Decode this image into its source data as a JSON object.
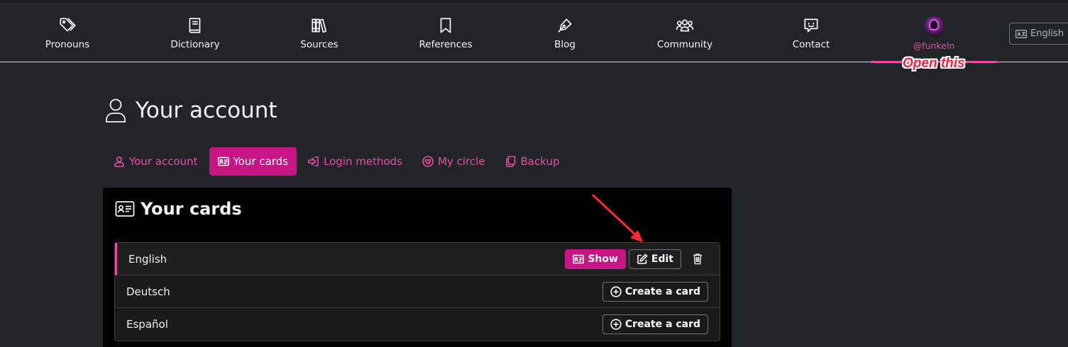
{
  "nav": {
    "items": [
      {
        "label": "Pronouns",
        "icon": "tags-icon"
      },
      {
        "label": "Dictionary",
        "icon": "book-icon"
      },
      {
        "label": "Sources",
        "icon": "books-icon"
      },
      {
        "label": "References",
        "icon": "bookmark-icon"
      },
      {
        "label": "Blog",
        "icon": "pen-nib-icon"
      },
      {
        "label": "Community",
        "icon": "users-icon"
      },
      {
        "label": "Contact",
        "icon": "comment-icon"
      }
    ],
    "user": {
      "label": "@funkeln",
      "icon": "avatar"
    },
    "language": {
      "label": "English",
      "icon": "language-icon"
    }
  },
  "annotation": {
    "text": "Open this",
    "color": "#ff1f3d"
  },
  "page": {
    "title": "Your account"
  },
  "tabs": [
    {
      "label": "Your account",
      "icon": "user-icon",
      "active": false
    },
    {
      "label": "Your cards",
      "icon": "id-card-icon",
      "active": true
    },
    {
      "label": "Login methods",
      "icon": "sign-in-icon",
      "active": false
    },
    {
      "label": "My circle",
      "icon": "heart-circle-icon",
      "active": false
    },
    {
      "label": "Backup",
      "icon": "copy-icon",
      "active": false
    }
  ],
  "cards": {
    "title": "Your cards",
    "rows": [
      {
        "language": "English",
        "show_label": "Show",
        "edit_label": "Edit"
      },
      {
        "language": "Deutsch",
        "create_label": "Create a card"
      },
      {
        "language": "Español",
        "create_label": "Create a card"
      }
    ]
  },
  "colors": {
    "accent": "#c71585",
    "accent_text": "#e94ba5",
    "background": "#212529"
  }
}
